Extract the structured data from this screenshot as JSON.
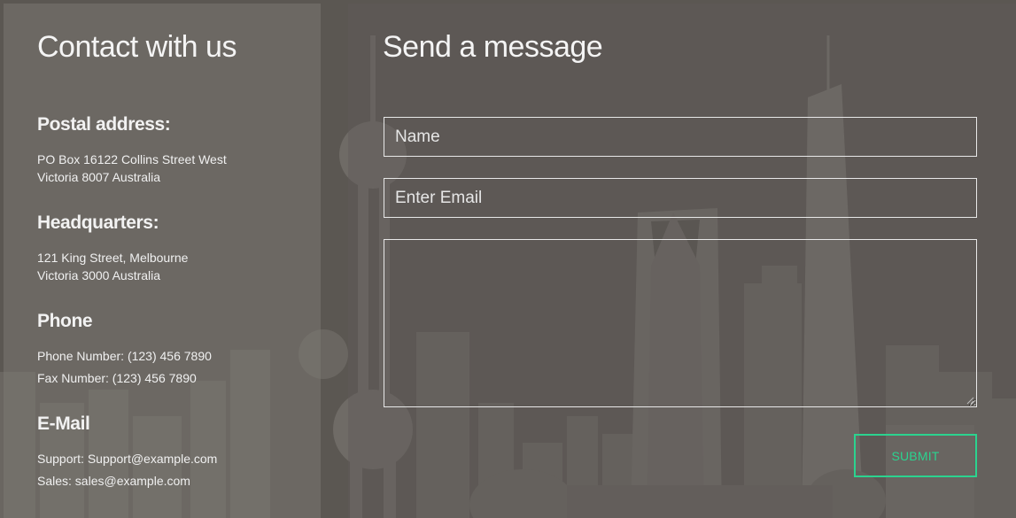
{
  "contact": {
    "title": "Contact with us",
    "postal": {
      "heading": "Postal address:",
      "line1": "PO Box 16122 Collins Street West",
      "line2": "Victoria 8007 Australia"
    },
    "hq": {
      "heading": "Headquarters:",
      "line1": "121 King Street, Melbourne",
      "line2": "Victoria 3000 Australia"
    },
    "phone": {
      "heading": "Phone",
      "phone_line": "Phone Number: (123) 456 7890",
      "fax_line": "Fax Number: (123) 456 7890"
    },
    "email": {
      "heading": "E-Mail",
      "support_line": "Support: Support@example.com",
      "sales_line": "Sales: sales@example.com"
    }
  },
  "form": {
    "title": "Send a message",
    "name_placeholder": "Name",
    "email_placeholder": "Enter Email",
    "message_placeholder": "",
    "submit_label": "SUBMIT"
  },
  "colors": {
    "accent": "#2bd38f",
    "overlay": "#4a4744"
  }
}
